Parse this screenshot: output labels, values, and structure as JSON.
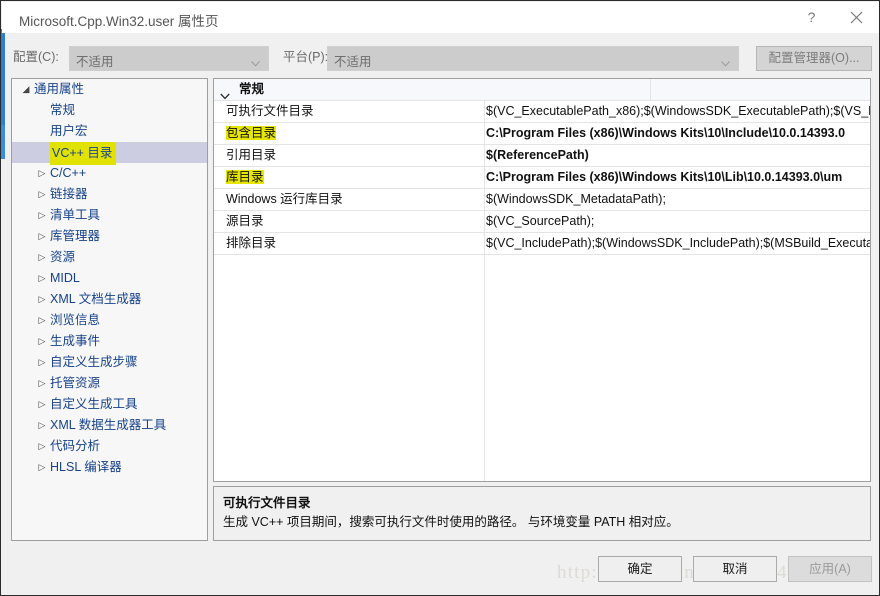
{
  "window": {
    "title": "Microsoft.Cpp.Win32.user 属性页",
    "help_icon": "question-mark-icon",
    "close_icon": "close-icon"
  },
  "config_bar": {
    "config_label": "配置(C):",
    "config_value": "不适用",
    "platform_label": "平台(P):",
    "platform_value": "不适用",
    "config_manager_button": "配置管理器(O)...",
    "dropdown_icon": "chevron-down-icon"
  },
  "tree": {
    "items": [
      {
        "label": "通用属性",
        "level": 0,
        "twisty": "expanded",
        "selected": false,
        "highlighted": false
      },
      {
        "label": "常规",
        "level": 1,
        "twisty": "none",
        "selected": false,
        "highlighted": false
      },
      {
        "label": "用户宏",
        "level": 1,
        "twisty": "none",
        "selected": false,
        "highlighted": false
      },
      {
        "label": "VC++ 目录",
        "level": 1,
        "twisty": "none",
        "selected": true,
        "highlighted": true
      },
      {
        "label": "C/C++",
        "level": 1,
        "twisty": "collapsed",
        "selected": false,
        "highlighted": false
      },
      {
        "label": "链接器",
        "level": 1,
        "twisty": "collapsed",
        "selected": false,
        "highlighted": false
      },
      {
        "label": "清单工具",
        "level": 1,
        "twisty": "collapsed",
        "selected": false,
        "highlighted": false
      },
      {
        "label": "库管理器",
        "level": 1,
        "twisty": "collapsed",
        "selected": false,
        "highlighted": false
      },
      {
        "label": "资源",
        "level": 1,
        "twisty": "collapsed",
        "selected": false,
        "highlighted": false
      },
      {
        "label": "MIDL",
        "level": 1,
        "twisty": "collapsed",
        "selected": false,
        "highlighted": false
      },
      {
        "label": "XML 文档生成器",
        "level": 1,
        "twisty": "collapsed",
        "selected": false,
        "highlighted": false
      },
      {
        "label": "浏览信息",
        "level": 1,
        "twisty": "collapsed",
        "selected": false,
        "highlighted": false
      },
      {
        "label": "生成事件",
        "level": 1,
        "twisty": "collapsed",
        "selected": false,
        "highlighted": false
      },
      {
        "label": "自定义生成步骤",
        "level": 1,
        "twisty": "collapsed",
        "selected": false,
        "highlighted": false
      },
      {
        "label": "托管资源",
        "level": 1,
        "twisty": "collapsed",
        "selected": false,
        "highlighted": false
      },
      {
        "label": "自定义生成工具",
        "level": 1,
        "twisty": "collapsed",
        "selected": false,
        "highlighted": false
      },
      {
        "label": "XML 数据生成器工具",
        "level": 1,
        "twisty": "collapsed",
        "selected": false,
        "highlighted": false
      },
      {
        "label": "代码分析",
        "level": 1,
        "twisty": "collapsed",
        "selected": false,
        "highlighted": false
      },
      {
        "label": "HLSL 编译器",
        "level": 1,
        "twisty": "collapsed",
        "selected": false,
        "highlighted": false
      }
    ]
  },
  "grid": {
    "category": "常规",
    "category_icon": "chevron-down-icon",
    "rows": [
      {
        "name": "可执行文件目录",
        "value": "$(VC_ExecutablePath_x86);$(WindowsSDK_ExecutablePath);$(VS_E",
        "bold": false,
        "highlighted": false
      },
      {
        "name": "包含目录",
        "value": "C:\\Program Files (x86)\\Windows Kits\\10\\Include\\10.0.14393.0",
        "bold": true,
        "highlighted": true
      },
      {
        "name": "引用目录",
        "value": "$(ReferencePath)",
        "bold": true,
        "highlighted": false
      },
      {
        "name": "库目录",
        "value": "C:\\Program Files (x86)\\Windows Kits\\10\\Lib\\10.0.14393.0\\um",
        "bold": true,
        "highlighted": true
      },
      {
        "name": "Windows 运行库目录",
        "value": "$(WindowsSDK_MetadataPath);",
        "bold": false,
        "highlighted": false
      },
      {
        "name": "源目录",
        "value": "$(VC_SourcePath);",
        "bold": false,
        "highlighted": false
      },
      {
        "name": "排除目录",
        "value": "$(VC_IncludePath);$(WindowsSDK_IncludePath);$(MSBuild_Executa",
        "bold": false,
        "highlighted": false
      }
    ]
  },
  "description": {
    "title": "可执行文件目录",
    "body": "生成 VC++ 项目期间，搜索可执行文件时使用的路径。  与环境变量 PATH 相对应。"
  },
  "footer": {
    "ok": "确定",
    "cancel": "取消",
    "apply": "应用(A)",
    "watermark": "http://blog.csdn.net/qq_34362856"
  }
}
